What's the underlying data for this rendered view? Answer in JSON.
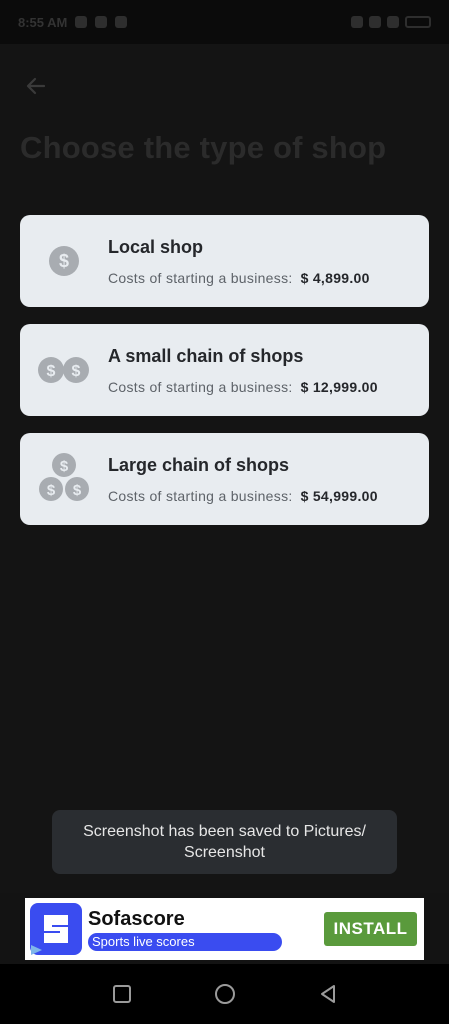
{
  "status_bar": {
    "time": "8:55 AM"
  },
  "page": {
    "title": "Choose the type of shop"
  },
  "shops": [
    {
      "title": "Local shop",
      "cost_label": "Costs of starting a business:",
      "cost_value": "$ 4,899.00",
      "icon": "single-coin-icon"
    },
    {
      "title": "A small chain of shops",
      "cost_label": "Costs of starting a business:",
      "cost_value": "$ 12,999.00",
      "icon": "two-coins-icon"
    },
    {
      "title": "Large chain of shops",
      "cost_label": "Costs of starting a business:",
      "cost_value": "$ 54,999.00",
      "icon": "three-coins-icon"
    }
  ],
  "toast": {
    "message": "Screenshot has been saved to  Pictures/ Screenshot"
  },
  "ad": {
    "app_name": "Sofascore",
    "tagline": "Sports live scores",
    "install_label": "INSTALL"
  },
  "colors": {
    "background": "#141414",
    "card_background": "#e8ecf0",
    "coin": "#a8acb1",
    "install_button": "#5a9a3c",
    "ad_brand": "#3a4cf0"
  }
}
